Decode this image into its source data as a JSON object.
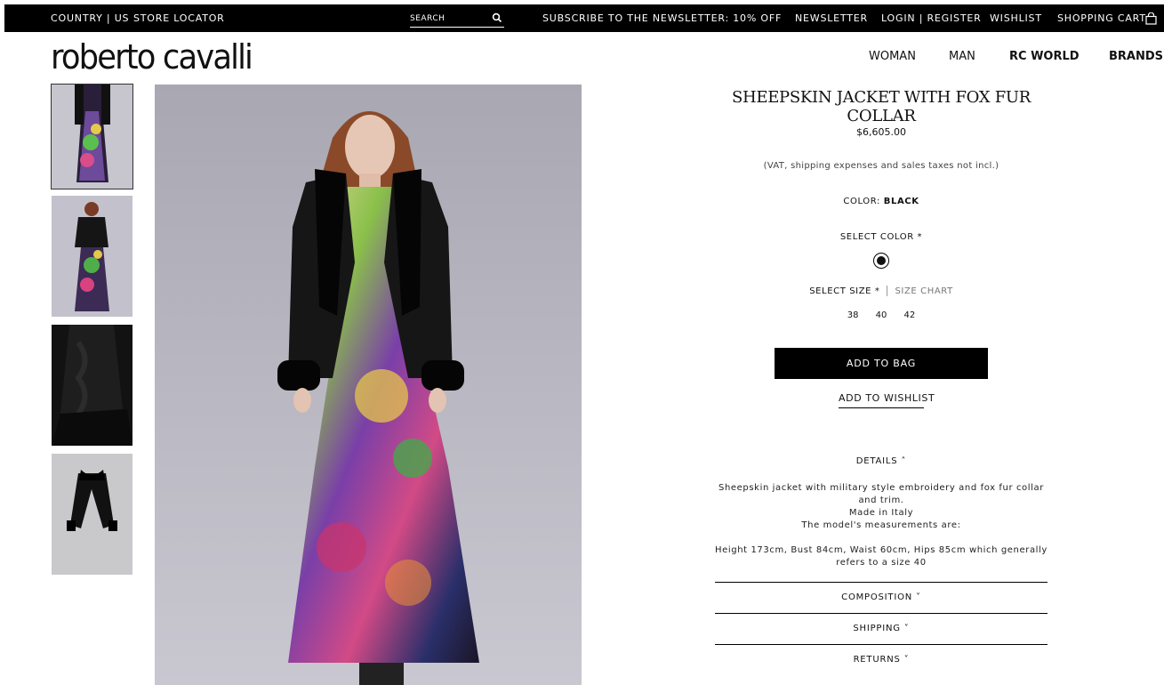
{
  "topbar": {
    "country": "COUNTRY | US",
    "store_locator": "STORE LOCATOR",
    "search_placeholder": "SEARCH",
    "newsletter_promo": "SUBSCRIBE TO THE NEWSLETTER: 10% OFF",
    "newsletter": "NEWSLETTER",
    "login": "LOGIN | REGISTER",
    "wishlist": "WISHLIST",
    "cart": "SHOPPING CART"
  },
  "header": {
    "logo": "roberto cavalli",
    "nav": [
      "WOMAN",
      "MAN",
      "RC WORLD",
      "BRANDS"
    ]
  },
  "product": {
    "title": "SHEEPSKIN JACKET WITH FOX FUR COLLAR",
    "price": "$6,605.00",
    "tax_note": "(VAT, shipping expenses and sales taxes not incl.)",
    "color_label": "COLOR:",
    "color_value": "BLACK",
    "select_color": "SELECT COLOR *",
    "select_size": "SELECT SIZE *",
    "size_chart": "SIZE CHART",
    "sizes": [
      "38",
      "40",
      "42"
    ],
    "add_to_bag": "ADD TO BAG",
    "add_to_wishlist": "ADD TO WISHLIST",
    "details_label": "DETAILS ˄",
    "details_lines": [
      "Sheepskin jacket with military style embroidery and fox fur collar and trim.",
      "Made in Italy",
      "The model's measurements are:",
      "",
      "Height 173cm, Bust 84cm, Waist 60cm, Hips 85cm which generally refers to a size 40"
    ],
    "composition_label": "COMPOSITION ˅",
    "shipping_label": "SHIPPING ˅",
    "returns_label": "RETURNS ˅"
  },
  "colors": {
    "topbar_bg": "#000000",
    "button_bg": "#000000",
    "image_bg": "#b7b5c0"
  }
}
